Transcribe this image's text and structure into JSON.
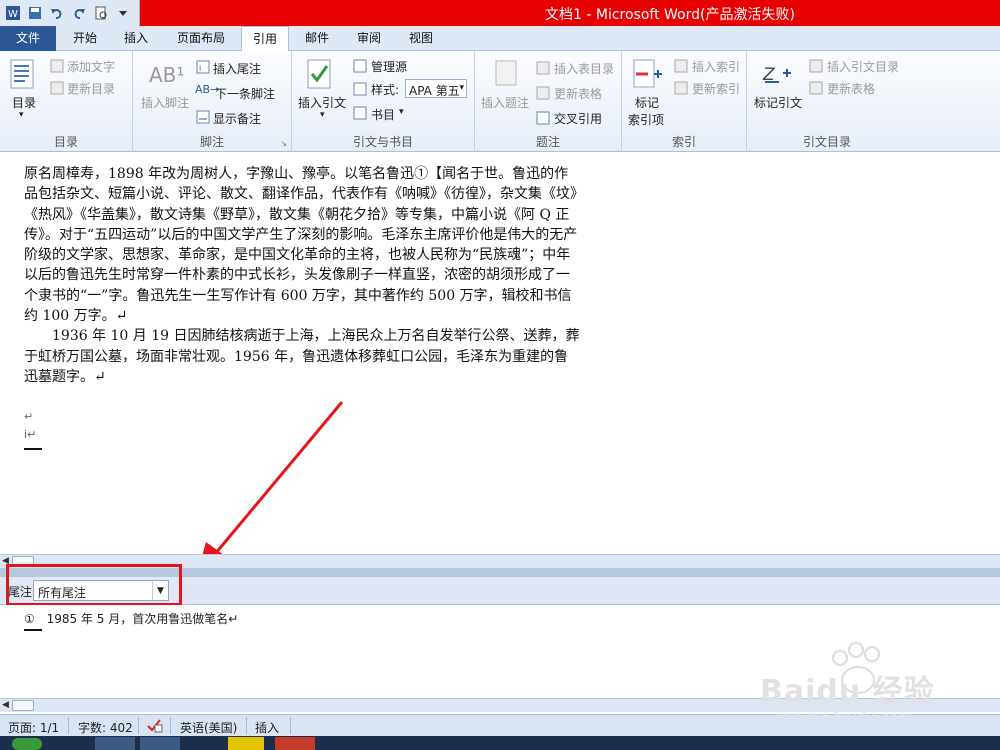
{
  "window": {
    "title": "文档1 - Microsoft Word(产品激活失败)"
  },
  "tabs": [
    "文件",
    "开始",
    "插入",
    "页面布局",
    "引用",
    "邮件",
    "审阅",
    "视图"
  ],
  "ribbon": {
    "toc": {
      "label": "目录",
      "add_text": "添加文字",
      "update_toc": "更新目录",
      "group": "目录"
    },
    "footnote": {
      "insert_footnote": "插入脚注",
      "insert_endnote": "插入尾注",
      "next_footnote": "下一条脚注",
      "show_notes": "显示备注",
      "group": "脚注"
    },
    "citation": {
      "insert_citation": "插入引文",
      "manage_sources": "管理源",
      "style_label": "样式:",
      "style_value": "APA 第五",
      "bibliography": "书目",
      "group": "引文与书目"
    },
    "caption": {
      "insert_caption": "插入题注",
      "insert_table_of_figures": "插入表目录",
      "update_table": "更新表格",
      "cross_reference": "交叉引用",
      "group": "题注"
    },
    "index": {
      "mark_entry_line1": "标记",
      "mark_entry_line2": "索引项",
      "insert_index": "插入索引",
      "update_index": "更新索引",
      "group": "索引"
    },
    "authorities": {
      "mark_citation": "标记引文",
      "insert_toa": "插入引文目录",
      "update_table": "更新表格",
      "group": "引文目录"
    }
  },
  "document": {
    "paragraph1": "原名周樟寿，1898 年改为周树人，字豫山、豫亭。以笔名鲁迅①【闻名于世。鲁迅的作品包括杂文、短篇小说、评论、散文、翻译作品，代表作有《呐喊》《彷徨》，杂文集《坟》《热风》《华盖集》，散文诗集《野草》，散文集《朝花夕拾》等专集，中篇小说《阿 Q 正传》。对于“五四运动”以后的中国文学产生了深刻的影响。毛泽东主席评价他是伟大的无产阶级的文学家、思想家、革命家，是中国文化革命的主将，也被人民称为“民族魂”；中年以后的鲁迅先生时常穿一件朴素的中式长衫，头发像刷子一样直竖，浓密的胡须形成了一个隶书的“一”字。鲁迅先生一生写作计有 600 万字，其中著作约 500 万字，辑校和书信约 100 万字。↵",
    "paragraph2": "1936 年 10 月 19 日因肺结核病逝于上海，上海民众上万名自发举行公祭、送葬，葬于虹桥万国公墓，场面非常壮观。1956 年，鲁迅遗体移葬虹口公园，毛泽东为重建的鲁迅墓题字。↵",
    "mark1": "↵",
    "mark2": "i↵"
  },
  "note_pane": {
    "label": "尾注",
    "selected": "所有尾注",
    "endnote_mark": "①",
    "endnote_text": "1985 年 5 月，首次用鲁迅做笔名↵"
  },
  "statusbar": {
    "page": "页面: 1/1",
    "words": "字数: 402",
    "language": "英语(美国)",
    "mode": "插入"
  },
  "watermark": {
    "brand": "Baidu 经验",
    "url": "jingyan.baidu.com"
  },
  "colors": {
    "titlebar": "#e60000",
    "file_tab": "#2b5797",
    "highlight": "#e8141c"
  }
}
